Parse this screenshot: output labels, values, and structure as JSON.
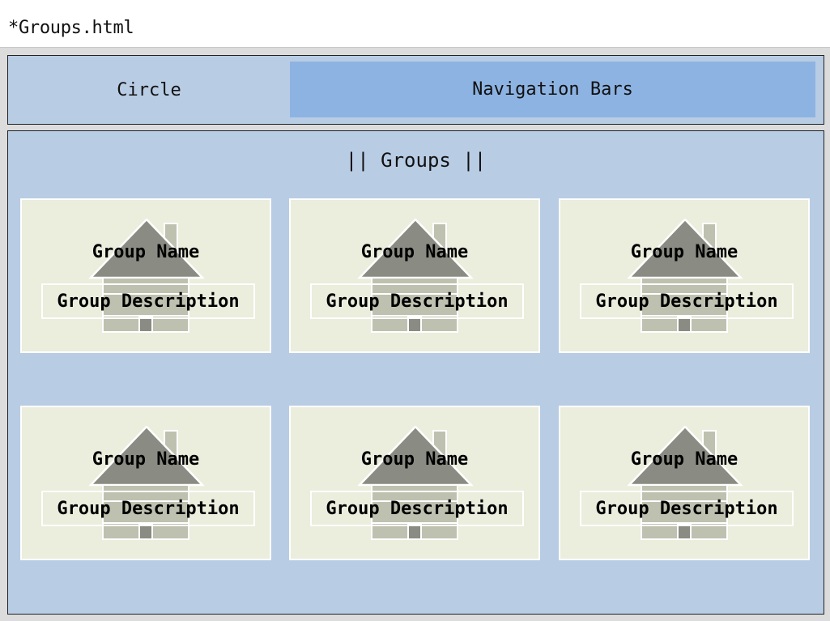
{
  "window": {
    "title": "*Groups.html"
  },
  "header": {
    "logo_label": "Circle",
    "nav_label": "Navigation Bars"
  },
  "main": {
    "heading": "|| Groups ||",
    "cards": [
      {
        "name": "Group Name",
        "description": "Group Description",
        "icon": "house-icon"
      },
      {
        "name": "Group Name",
        "description": "Group Description",
        "icon": "house-icon"
      },
      {
        "name": "Group Name",
        "description": "Group Description",
        "icon": "house-icon"
      },
      {
        "name": "Group Name",
        "description": "Group Description",
        "icon": "house-icon"
      },
      {
        "name": "Group Name",
        "description": "Group Description",
        "icon": "house-icon"
      },
      {
        "name": "Group Name",
        "description": "Group Description",
        "icon": "house-icon"
      }
    ]
  },
  "colors": {
    "panel": "#b8cce4",
    "nav": "#8db3e2",
    "card": "#ebeddd",
    "house_roof": "#8a8b82",
    "house_body": "#bfc1b0"
  }
}
